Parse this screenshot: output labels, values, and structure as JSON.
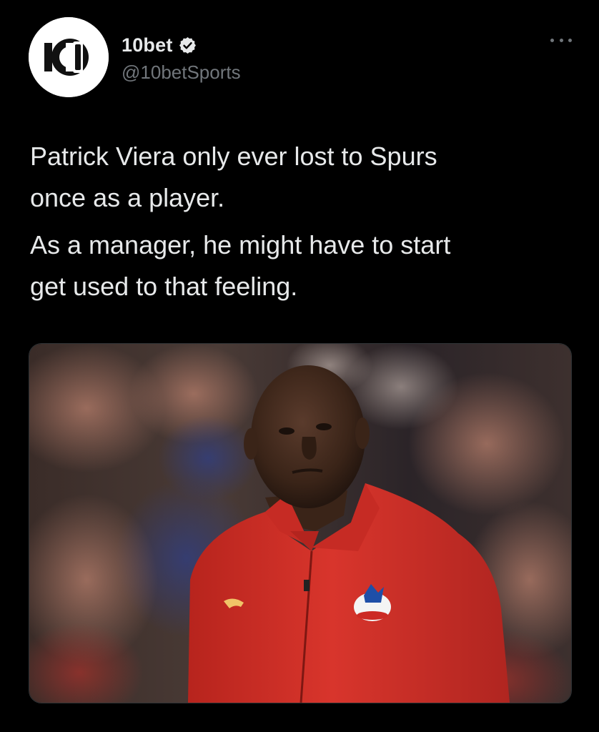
{
  "account": {
    "display_name": "10bet",
    "handle": "@10betSports",
    "verified_icon": "verified-badge-icon",
    "avatar_logo_text": "10 BET"
  },
  "menu": {
    "icon": "more-options-icon"
  },
  "tweet": {
    "paragraphs": [
      "Patrick Viera only ever lost to Spurs\nonce as a player.",
      "As a manager, he might have to start\nget used to that feeling."
    ]
  },
  "media": {
    "type": "photo",
    "subject": "man-in-red-jacket"
  },
  "colors": {
    "background": "#000000",
    "text_primary": "#e7e9ea",
    "text_secondary": "#71767b",
    "jacket_red": "#d42a22"
  }
}
